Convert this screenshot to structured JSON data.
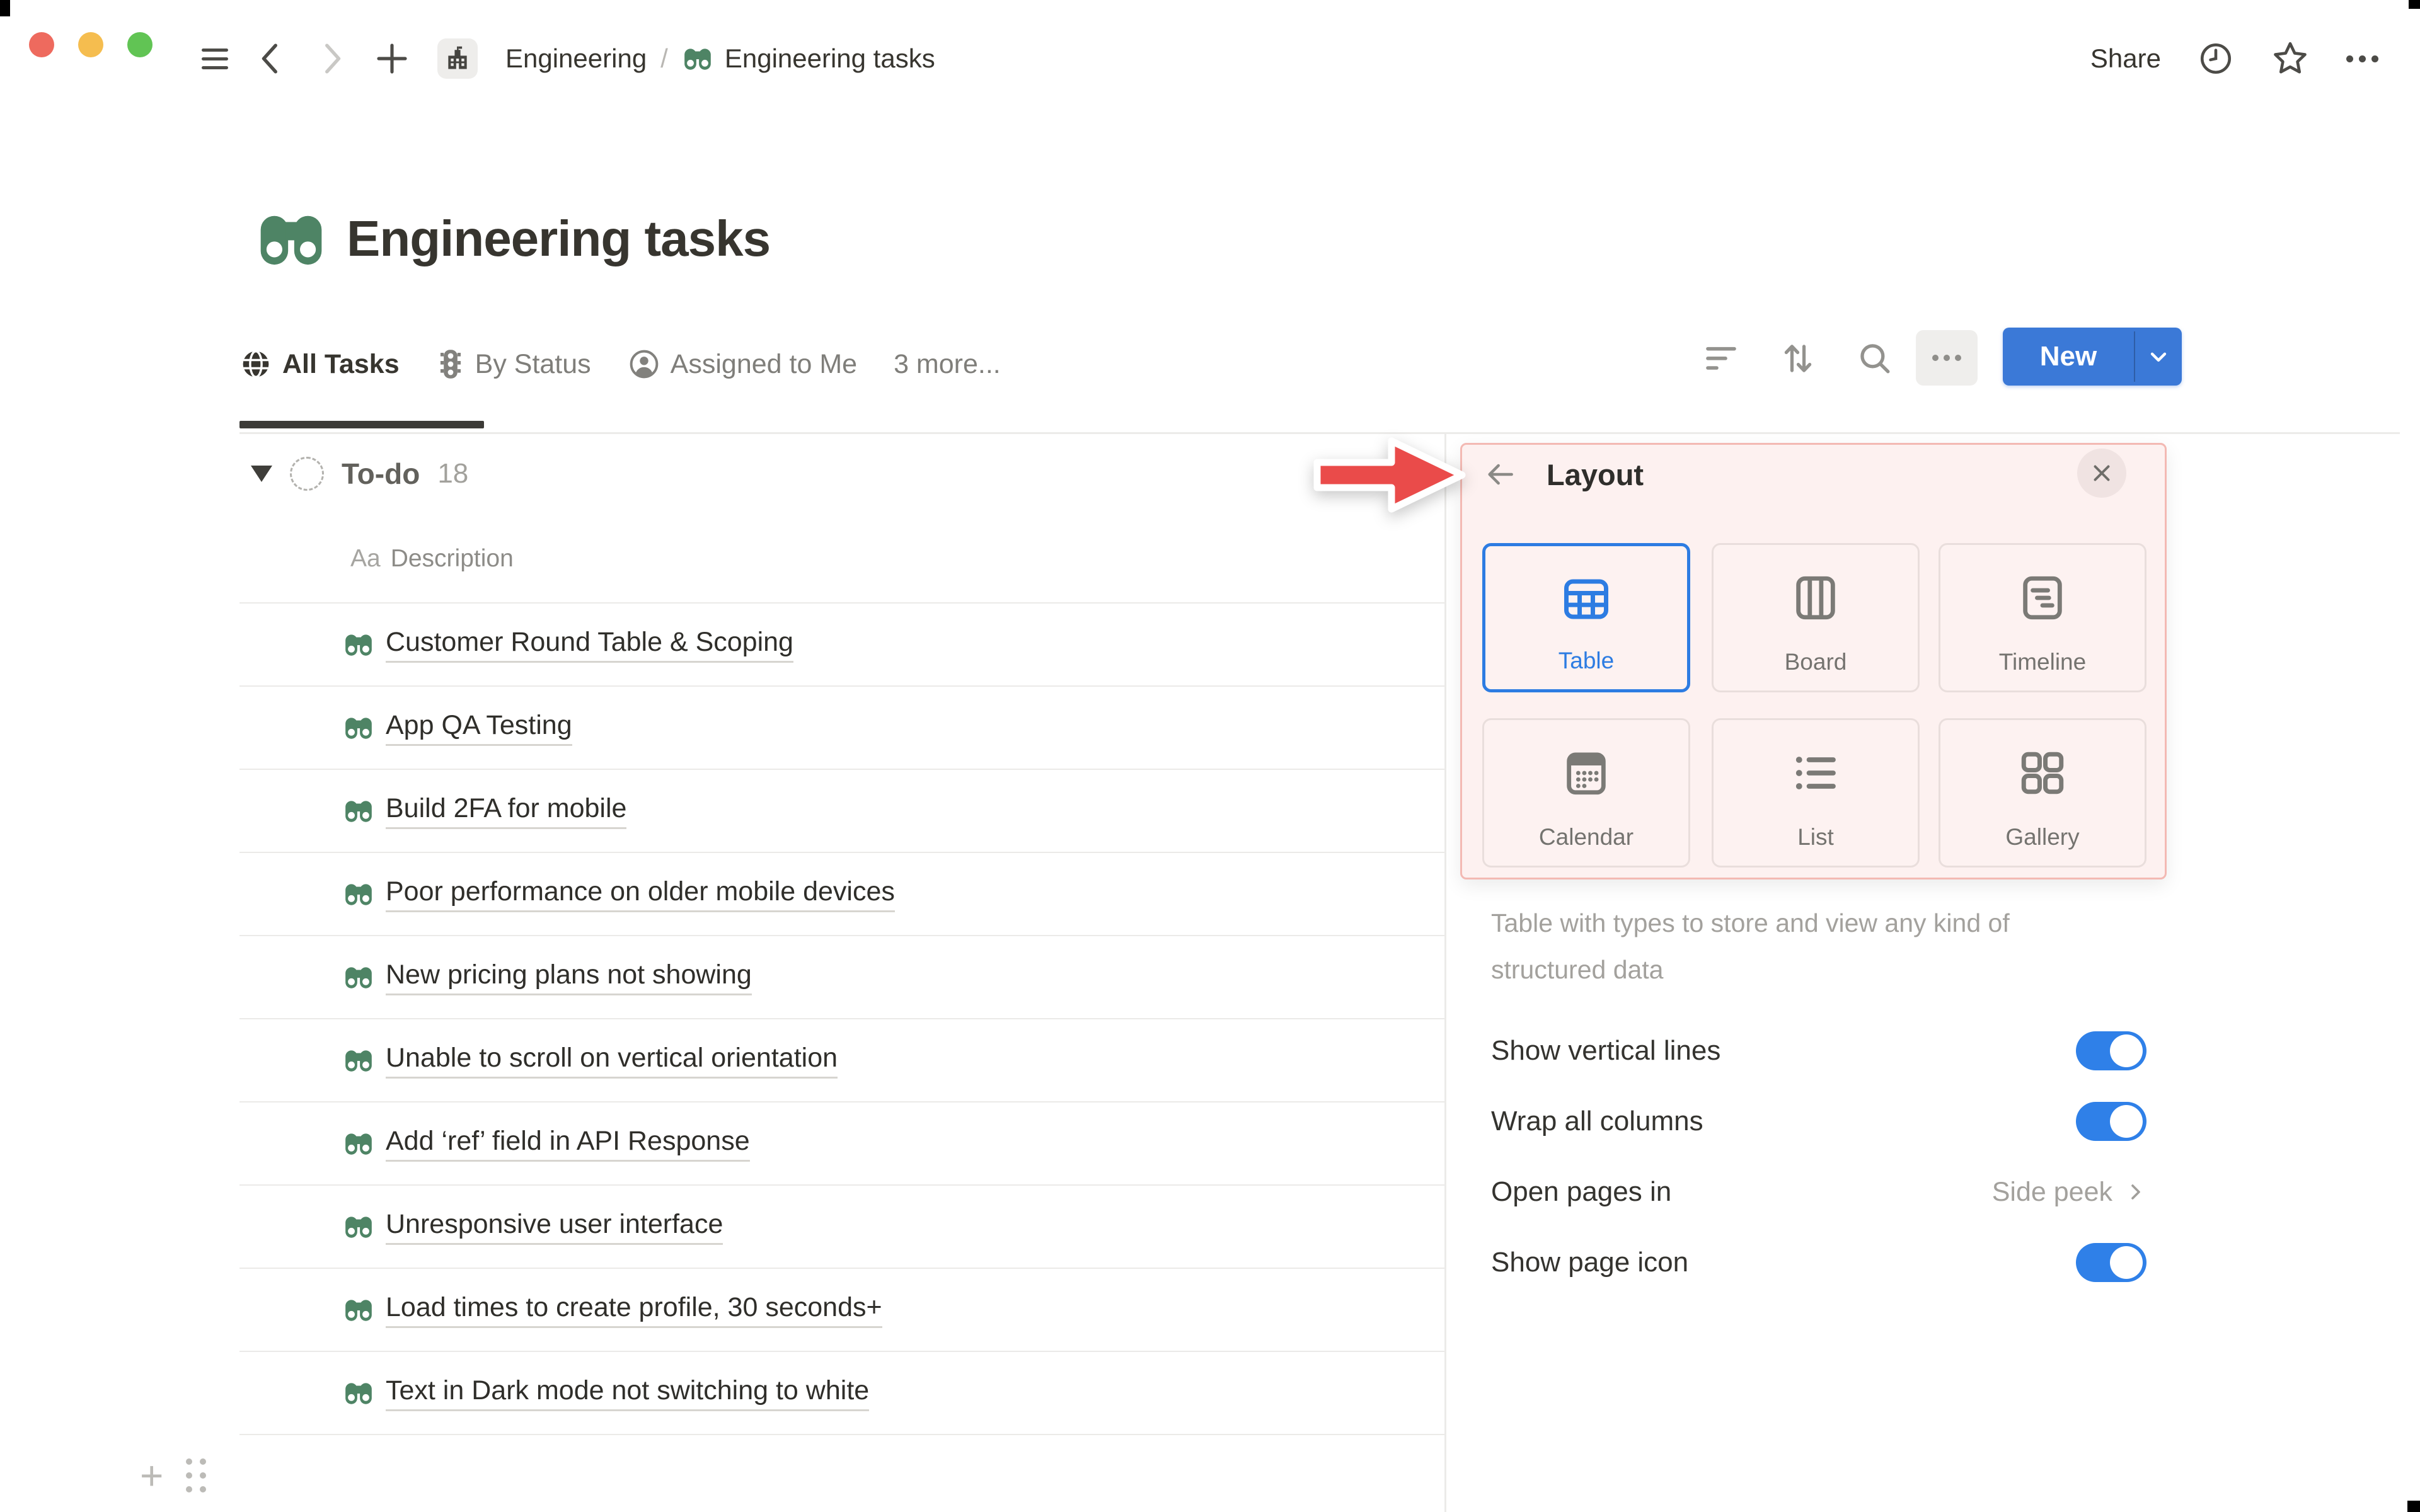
{
  "topbar": {
    "breadcrumb": {
      "workspace": "Engineering",
      "separator": "/",
      "page": "Engineering tasks"
    },
    "share_label": "Share"
  },
  "page": {
    "title": "Engineering tasks"
  },
  "tabs": [
    {
      "label": "All Tasks",
      "icon": "globe-icon",
      "active": true
    },
    {
      "label": "By Status",
      "icon": "traffic-light-icon",
      "active": false
    },
    {
      "label": "Assigned to Me",
      "icon": "person-icon",
      "active": false
    },
    {
      "label": "3 more...",
      "icon": null,
      "active": false
    }
  ],
  "toolbar": {
    "new_label": "New"
  },
  "group": {
    "name": "To-do",
    "count": "18",
    "column_prefix": "Aa",
    "column_name": "Description"
  },
  "tasks": [
    "Customer Round Table & Scoping",
    "App QA Testing",
    "Build 2FA for mobile",
    "Poor performance on older mobile devices",
    "New pricing plans not showing",
    "Unable to scroll on vertical orientation",
    "Add ‘ref’ field in API Response",
    "Unresponsive user interface",
    "Load times to create profile, 30 seconds+",
    "Text in Dark mode not switching to white"
  ],
  "panel": {
    "title": "Layout",
    "layouts": [
      {
        "label": "Table",
        "selected": true
      },
      {
        "label": "Board",
        "selected": false
      },
      {
        "label": "Timeline",
        "selected": false
      },
      {
        "label": "Calendar",
        "selected": false
      },
      {
        "label": "List",
        "selected": false
      },
      {
        "label": "Gallery",
        "selected": false
      }
    ],
    "description_line1": "Table with types to store and view any kind of",
    "description_line2": "structured data",
    "settings": [
      {
        "label": "Show vertical lines",
        "type": "toggle",
        "value": true
      },
      {
        "label": "Wrap all columns",
        "type": "toggle",
        "value": true
      },
      {
        "label": "Open pages in",
        "type": "link",
        "value": "Side peek"
      },
      {
        "label": "Show page icon",
        "type": "toggle",
        "value": true
      }
    ]
  },
  "colors": {
    "selected_blue": "#2d7ce2",
    "toggle_blue": "#2f80e8",
    "new_button_blue": "#3b79d7",
    "highlight_pink_bg": "#fdf1f0",
    "highlight_pink_border": "#f3b9b3",
    "annotation_arrow_red": "#ea4b4a",
    "page_icon_green": "#4e8465"
  }
}
